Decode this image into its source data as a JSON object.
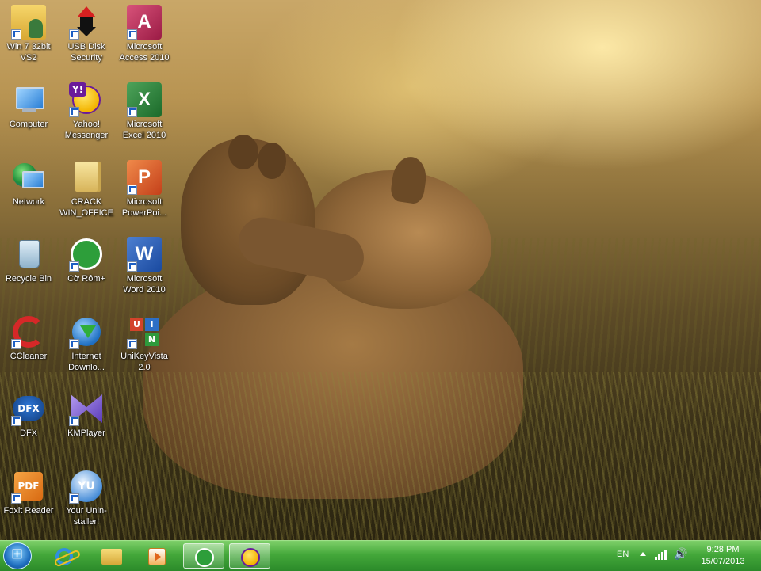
{
  "desktop": {
    "icons": [
      {
        "label": "Win 7 32bit VS2",
        "icon": "user-folder-icon"
      },
      {
        "label": "USB Disk Security",
        "icon": "usb-disk-security-icon"
      },
      {
        "label": "Microsoft Access 2010",
        "icon": "access-icon"
      },
      {
        "label": "Computer",
        "icon": "computer-icon"
      },
      {
        "label": "Yahoo! Messenger",
        "icon": "yahoo-messenger-icon"
      },
      {
        "label": "Microsoft Excel 2010",
        "icon": "excel-icon"
      },
      {
        "label": "Network",
        "icon": "network-icon"
      },
      {
        "label": "CRACK WIN_OFFICE",
        "icon": "folder-icon"
      },
      {
        "label": "Microsoft PowerPoi...",
        "icon": "powerpoint-icon"
      },
      {
        "label": "Recycle Bin",
        "icon": "recycle-bin-icon"
      },
      {
        "label": "Cờ Rôm+",
        "icon": "coc-coc-icon"
      },
      {
        "label": "Microsoft Word 2010",
        "icon": "word-icon"
      },
      {
        "label": "CCleaner",
        "icon": "ccleaner-icon"
      },
      {
        "label": "Internet Downlo...",
        "icon": "internet-download-manager-icon"
      },
      {
        "label": "UniKeyVista 2.0",
        "icon": "unikey-icon"
      },
      {
        "label": "DFX",
        "icon": "dfx-icon"
      },
      {
        "label": "KMPlayer",
        "icon": "kmplayer-icon"
      },
      {
        "label": "Foxit Reader",
        "icon": "foxit-reader-icon"
      },
      {
        "label": "Your Unin-staller!",
        "icon": "your-uninstaller-icon"
      }
    ],
    "icon_glyphs": {
      "access": "A",
      "excel": "X",
      "powerpoint": "P",
      "word": "W",
      "yahoo": "Y!",
      "dfx": "DFX",
      "foxit": "PDF",
      "yu": "YU",
      "unikey_u": "U",
      "unikey_i": "I",
      "unikey_n": "N"
    }
  },
  "taskbar": {
    "start": "start-button",
    "pinned": [
      {
        "name": "internet-explorer",
        "icon": "internet-explorer-icon"
      },
      {
        "name": "windows-explorer",
        "icon": "folder-icon"
      },
      {
        "name": "windows-media-player",
        "icon": "media-player-icon"
      },
      {
        "name": "coc-coc",
        "icon": "coc-coc-icon",
        "active": true
      },
      {
        "name": "yahoo-messenger",
        "icon": "yahoo-messenger-icon",
        "active": true
      }
    ],
    "tray": {
      "language": "EN",
      "time": "9:28 PM",
      "date": "15/07/2013"
    }
  },
  "colors": {
    "taskbar_top": "#7fd06a",
    "taskbar_bottom": "#2b8a2a"
  }
}
